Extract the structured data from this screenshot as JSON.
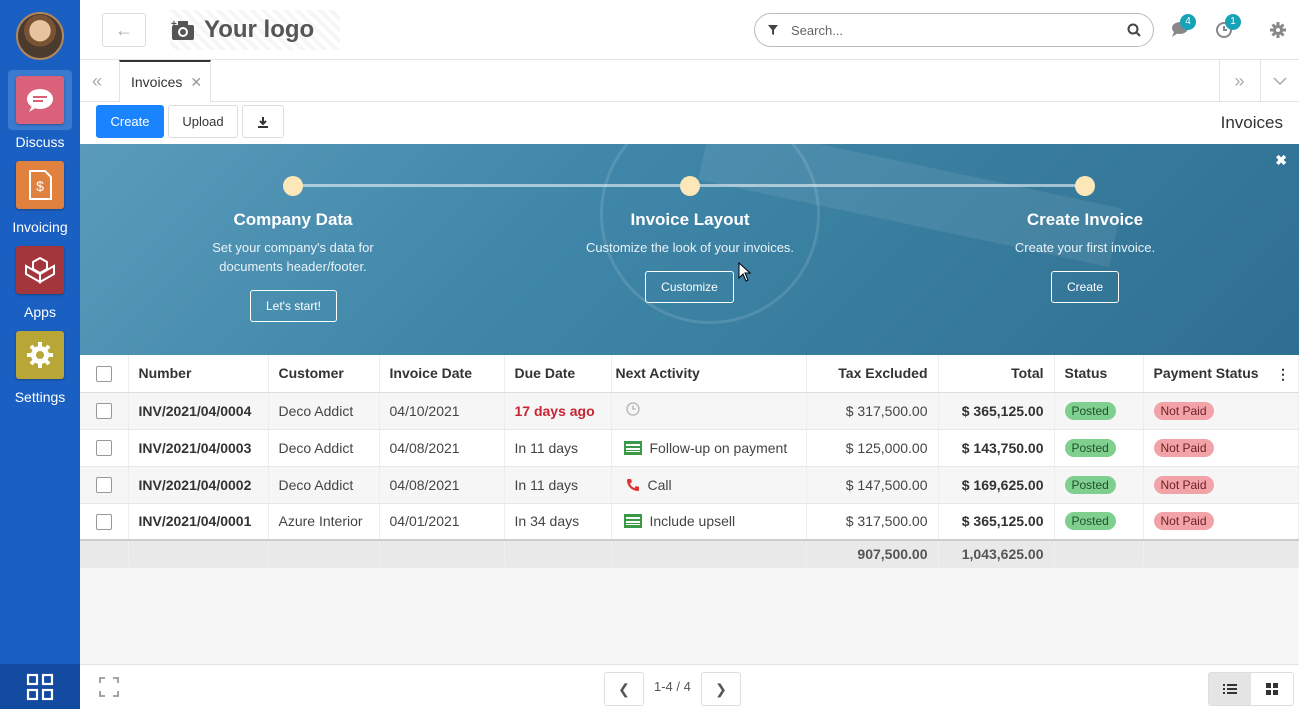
{
  "sidebar": {
    "apps": [
      {
        "label": "Discuss",
        "color": "#d9627a"
      },
      {
        "label": "Invoicing",
        "color": "#e0813f"
      },
      {
        "label": "Apps",
        "color": "#a3363d"
      },
      {
        "label": "Settings",
        "color": "#b8a637"
      }
    ]
  },
  "topbar": {
    "logo_text": "Your logo",
    "search_placeholder": "Search...",
    "messages_count": "4",
    "activities_count": "1"
  },
  "tabs": [
    {
      "label": "Invoices"
    }
  ],
  "controls": {
    "create_label": "Create",
    "upload_label": "Upload",
    "breadcrumb": "Invoices"
  },
  "banner": {
    "steps": [
      {
        "title": "Company Data",
        "text": "Set your company's data for documents header/footer.",
        "button": "Let's start!"
      },
      {
        "title": "Invoice Layout",
        "text": "Customize the look of your invoices.",
        "button": "Customize"
      },
      {
        "title": "Create Invoice",
        "text": "Create your first invoice.",
        "button": "Create"
      }
    ]
  },
  "table": {
    "columns": [
      "Number",
      "Customer",
      "Invoice Date",
      "Due Date",
      "Next Activity",
      "Tax Excluded",
      "Total",
      "Status",
      "Payment Status"
    ],
    "rows": [
      {
        "number": "INV/2021/04/0004",
        "customer": "Deco Addict",
        "invoice_date": "04/10/2021",
        "due_date": "17 days ago",
        "activity": "",
        "activity_icon": "clock-icon",
        "tax_excluded": "$ 317,500.00",
        "total": "$ 365,125.00",
        "status": "Posted",
        "payment_status": "Not Paid"
      },
      {
        "number": "INV/2021/04/0003",
        "customer": "Deco Addict",
        "invoice_date": "04/08/2021",
        "due_date": "In 11 days",
        "activity": "Follow-up on payment",
        "activity_icon": "money-icon",
        "tax_excluded": "$ 125,000.00",
        "total": "$ 143,750.00",
        "status": "Posted",
        "payment_status": "Not Paid"
      },
      {
        "number": "INV/2021/04/0002",
        "customer": "Deco Addict",
        "invoice_date": "04/08/2021",
        "due_date": "In 11 days",
        "activity": "Call",
        "activity_icon": "phone-icon",
        "tax_excluded": "$ 147,500.00",
        "total": "$ 169,625.00",
        "status": "Posted",
        "payment_status": "Not Paid"
      },
      {
        "number": "INV/2021/04/0001",
        "customer": "Azure Interior",
        "invoice_date": "04/01/2021",
        "due_date": "In 34 days",
        "activity": "Include upsell",
        "activity_icon": "money-icon",
        "tax_excluded": "$ 317,500.00",
        "total": "$ 365,125.00",
        "status": "Posted",
        "payment_status": "Not Paid"
      }
    ],
    "totals": {
      "tax_excluded": "907,500.00",
      "total": "1,043,625.00"
    }
  },
  "pager": {
    "text": "1-4 / 4"
  }
}
